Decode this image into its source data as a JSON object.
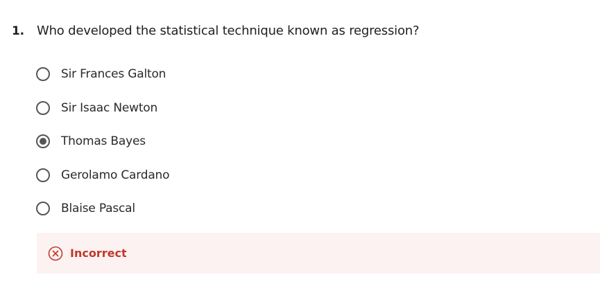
{
  "question": {
    "number": "1.",
    "text": "Who developed the statistical technique known as regression?"
  },
  "options": [
    {
      "label": "Sir Frances Galton",
      "selected": false
    },
    {
      "label": "Sir Isaac Newton",
      "selected": false
    },
    {
      "label": "Thomas Bayes",
      "selected": true
    },
    {
      "label": "Gerolamo Cardano",
      "selected": false
    },
    {
      "label": "Blaise Pascal",
      "selected": false
    }
  ],
  "feedback": {
    "icon": "x-circle-icon",
    "label": "Incorrect",
    "color": "#c0392b",
    "background": "#fdf2f2"
  }
}
